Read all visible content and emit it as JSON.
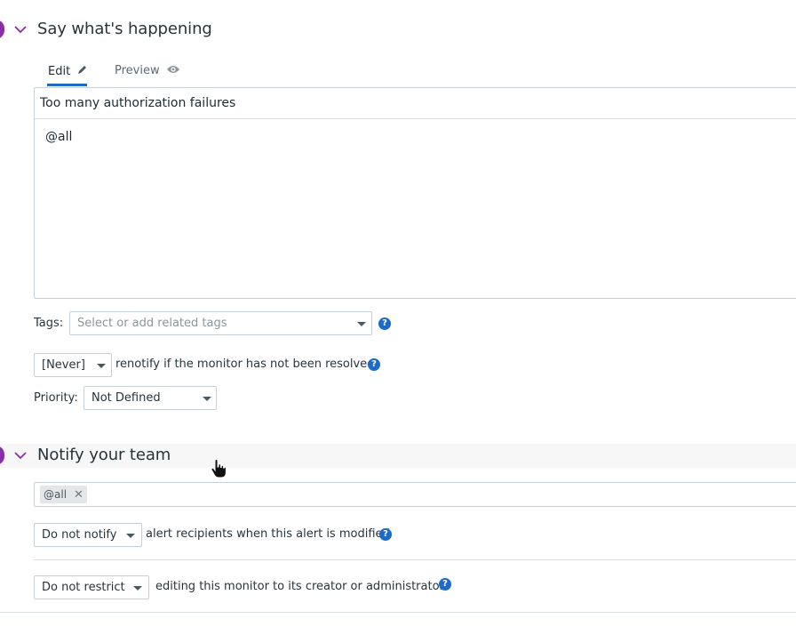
{
  "section1": {
    "title": "Say what's happening",
    "tabs": {
      "edit": "Edit",
      "preview": "Preview"
    },
    "message_title": "Too many authorization failures",
    "message_body": "@all"
  },
  "tags": {
    "label": "Tags:",
    "placeholder": "Select or add related tags"
  },
  "renotify": {
    "value": "[Never]",
    "text": "renotify if the monitor has not been resolved"
  },
  "priority": {
    "label": "Priority:",
    "value": "Not Defined"
  },
  "section2": {
    "title": "Notify your team",
    "recipients": [
      "@all"
    ],
    "notify_value": "Do not notify",
    "notify_text": "alert recipients when this alert is modified",
    "restrict_value": "Do not restrict",
    "restrict_text": "editing this monitor to its creator or administrators"
  },
  "help_glyph": "?",
  "colors": {
    "accent": "#1d6bc6",
    "step": "#8a2ea6"
  }
}
